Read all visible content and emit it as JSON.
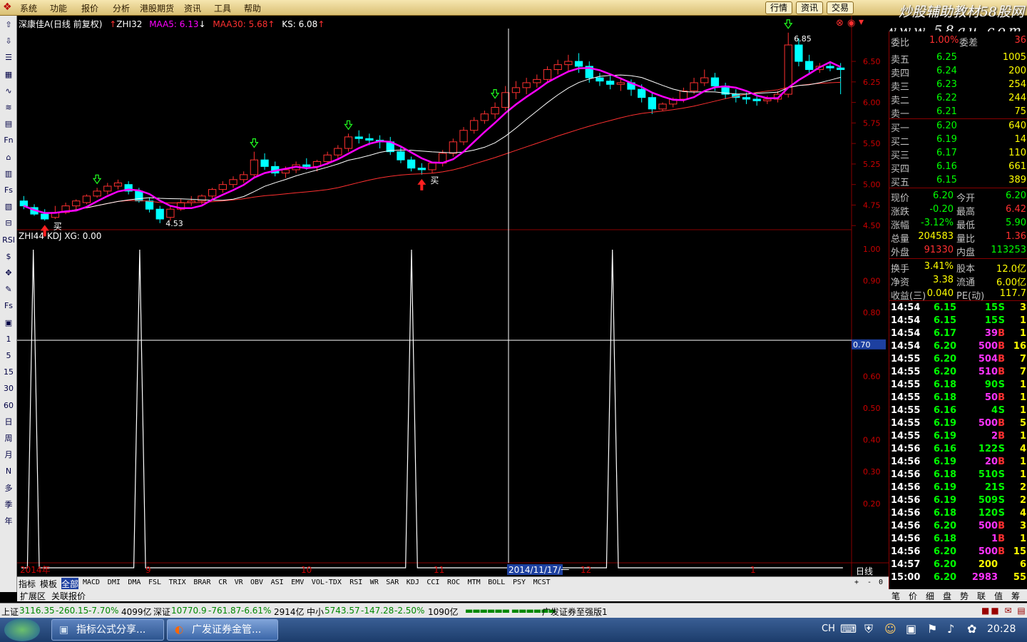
{
  "menu": {
    "items": [
      "系统",
      "功能",
      "报价",
      "分析",
      "港股期货",
      "资讯",
      "工具",
      "帮助"
    ],
    "center_title": "",
    "quick_buttons": [
      "行情",
      "资讯",
      "交易"
    ]
  },
  "watermark": {
    "line1": "炒股辅助教材58股网",
    "line2": "www.58gu.com"
  },
  "left_toolbar": [
    "⇧",
    "⇩",
    "☰",
    "▦",
    "∿",
    "≋",
    "▤",
    "Fn",
    "⌂",
    "▥",
    "Fs",
    "▧",
    "⊟",
    "RSI",
    "$",
    "✥",
    "✎",
    "Fs",
    "▣",
    "1",
    "5",
    "15",
    "30",
    "60",
    "日",
    "周",
    "月",
    "N",
    "多",
    "季",
    "年"
  ],
  "main_chart": {
    "stock": "深康佳A",
    "period": "(日线 前复权)",
    "ind": "ZHI32",
    "maa5_label": "MAA5: 6.13",
    "maa30_label": "MAA30: 5.68",
    "ks_label": "KS: 6.08",
    "y_ticks": [
      "6.50",
      "6.25",
      "6.00",
      "5.75",
      "5.50",
      "5.25",
      "5.00",
      "4.75",
      "4.50"
    ],
    "hi_label": "6.85",
    "lo_label": "4.53",
    "buy_label": "买"
  },
  "sub_chart": {
    "title": "ZHI44 KDJ XG: 0.00",
    "y_ticks": [
      "1.00",
      "0.90",
      "0.80",
      "0.70",
      "0.60",
      "0.50",
      "0.40",
      "0.30",
      "0.20"
    ],
    "cursor_value": "0.70"
  },
  "x_axis": {
    "labels": [
      "2014年",
      "9",
      "10",
      "11",
      "2014/11/17/一",
      "12",
      "1"
    ],
    "period": "日线"
  },
  "indicator_tabs": [
    "指标",
    "模板",
    "全部",
    "MACD",
    "DMI",
    "DMA",
    "FSL",
    "TRIX",
    "BRAR",
    "CR",
    "VR",
    "OBV",
    "ASI",
    "EMV",
    "VOL-TDX",
    "RSI",
    "WR",
    "SAR",
    "KDJ",
    "CCI",
    "ROC",
    "MTM",
    "BOLL",
    "PSY",
    "MCST"
  ],
  "indicator_tabs2": [
    "扩展区",
    "关联报价"
  ],
  "tab_controls": [
    "+",
    "-",
    "0"
  ],
  "quote": {
    "wei_label": "委比",
    "wei_value": "1.00%",
    "wei_cha_label": "委差",
    "wei_cha": "36",
    "asks": [
      {
        "label": "卖五",
        "price": "6.25",
        "vol": "1005"
      },
      {
        "label": "卖四",
        "price": "6.24",
        "vol": "200"
      },
      {
        "label": "卖三",
        "price": "6.23",
        "vol": "254"
      },
      {
        "label": "卖二",
        "price": "6.22",
        "vol": "244"
      },
      {
        "label": "卖一",
        "price": "6.21",
        "vol": "75"
      }
    ],
    "bids": [
      {
        "label": "买一",
        "price": "6.20",
        "vol": "640"
      },
      {
        "label": "买二",
        "price": "6.19",
        "vol": "14"
      },
      {
        "label": "买三",
        "price": "6.17",
        "vol": "110"
      },
      {
        "label": "买四",
        "price": "6.16",
        "vol": "661"
      },
      {
        "label": "买五",
        "price": "6.15",
        "vol": "389"
      }
    ],
    "stats": [
      {
        "l1": "现价",
        "v1": "6.20",
        "c1": "#00ff00",
        "l2": "今开",
        "v2": "6.20",
        "c2": "#00ff00"
      },
      {
        "l1": "涨跌",
        "v1": "-0.20",
        "c1": "#00ff00",
        "l2": "最高",
        "v2": "6.42",
        "c2": "#ff3030"
      },
      {
        "l1": "涨幅",
        "v1": "-3.12%",
        "c1": "#00ff00",
        "l2": "最低",
        "v2": "5.90",
        "c2": "#00ff00"
      },
      {
        "l1": "总量",
        "v1": "204583",
        "c1": "#ffff00",
        "l2": "量比",
        "v2": "1.36",
        "c2": "#ff3030"
      },
      {
        "l1": "外盘",
        "v1": "91330",
        "c1": "#ff3030",
        "l2": "内盘",
        "v2": "113253",
        "c2": "#00ff00"
      },
      {
        "l1": "换手",
        "v1": "3.41%",
        "c1": "#ffff00",
        "l2": "股本",
        "v2": "12.0亿",
        "c2": "#ffff00"
      },
      {
        "l1": "净资",
        "v1": "3.38",
        "c1": "#ffff00",
        "l2": "流通",
        "v2": "6.00亿",
        "c2": "#ffff00"
      },
      {
        "l1": "收益(三)",
        "v1": "0.040",
        "c1": "#ffff00",
        "l2": "PE(动)",
        "v2": "117.7",
        "c2": "#ffff00"
      }
    ]
  },
  "ticks": [
    {
      "t": "14:54",
      "p": "6.15",
      "v": "15",
      "s": "S",
      "n": "3"
    },
    {
      "t": "14:54",
      "p": "6.15",
      "v": "15",
      "s": "S",
      "n": "1"
    },
    {
      "t": "14:54",
      "p": "6.17",
      "v": "39",
      "s": "B",
      "n": "1"
    },
    {
      "t": "14:54",
      "p": "6.20",
      "v": "500",
      "s": "B",
      "n": "16"
    },
    {
      "t": "14:55",
      "p": "6.20",
      "v": "504",
      "s": "B",
      "n": "7"
    },
    {
      "t": "14:55",
      "p": "6.20",
      "v": "510",
      "s": "B",
      "n": "7"
    },
    {
      "t": "14:55",
      "p": "6.18",
      "v": "90",
      "s": "S",
      "n": "1"
    },
    {
      "t": "14:55",
      "p": "6.18",
      "v": "50",
      "s": "B",
      "n": "1"
    },
    {
      "t": "14:55",
      "p": "6.16",
      "v": "4",
      "s": "S",
      "n": "1"
    },
    {
      "t": "14:55",
      "p": "6.19",
      "v": "500",
      "s": "B",
      "n": "5"
    },
    {
      "t": "14:55",
      "p": "6.19",
      "v": "2",
      "s": "B",
      "n": "1"
    },
    {
      "t": "14:56",
      "p": "6.16",
      "v": "122",
      "s": "S",
      "n": "4"
    },
    {
      "t": "14:56",
      "p": "6.19",
      "v": "20",
      "s": "B",
      "n": "1"
    },
    {
      "t": "14:56",
      "p": "6.18",
      "v": "510",
      "s": "S",
      "n": "1"
    },
    {
      "t": "14:56",
      "p": "6.19",
      "v": "21",
      "s": "S",
      "n": "2"
    },
    {
      "t": "14:56",
      "p": "6.19",
      "v": "509",
      "s": "S",
      "n": "2"
    },
    {
      "t": "14:56",
      "p": "6.18",
      "v": "120",
      "s": "S",
      "n": "4"
    },
    {
      "t": "14:56",
      "p": "6.20",
      "v": "500",
      "s": "B",
      "n": "3"
    },
    {
      "t": "14:56",
      "p": "6.18",
      "v": "1",
      "s": "B",
      "n": "1"
    },
    {
      "t": "14:56",
      "p": "6.20",
      "v": "500",
      "s": "B",
      "n": "15"
    },
    {
      "t": "14:57",
      "p": "6.20",
      "v": "200",
      "s": "",
      "n": "6"
    },
    {
      "t": "15:00",
      "p": "6.20",
      "v": "2983",
      "s": "",
      "n": "55"
    }
  ],
  "right_tabs": [
    "笔",
    "价",
    "细",
    "盘",
    "势",
    "联",
    "值",
    "筹"
  ],
  "status": {
    "sh_label": "上证",
    "sh_val": "3116.35",
    "sh_chg": "-260.15",
    "sh_pct": "-7.70%",
    "sh_amt": "4099亿",
    "sz_label": "深证",
    "sz_val": "10770.9",
    "sz_chg": "-761.87",
    "sz_pct": "-6.61%",
    "sz_amt": "2914亿",
    "zx_label": "中小",
    "zx_val": "5743.57",
    "zx_chg": "-147.28",
    "zx_pct": "-2.50%",
    "zx_amt": "1090亿",
    "broker": "广发证券至强版1"
  },
  "taskbar": {
    "btn1": "指标公式分享...",
    "btn2": "广发证券金管...",
    "lang": "CH",
    "time": "20:28"
  },
  "colors": {
    "up": "#ff3030",
    "down": "#00ffff",
    "ma5": "#ff00ff",
    "ma30": "#ff3030",
    "ks": "#ffffff",
    "bid_green": "#00ff00"
  },
  "chart_data": [
    {
      "type": "candlestick",
      "title": "深康佳A (日线 前复权)",
      "ylim": [
        4.45,
        6.9
      ],
      "x_labels": [
        "2014年",
        "9",
        "10",
        "11",
        "12",
        "1"
      ],
      "candles": [
        [
          4.8,
          4.86,
          4.74,
          4.7
        ],
        [
          4.72,
          4.76,
          4.64,
          4.62
        ],
        [
          4.64,
          4.7,
          4.58,
          4.56
        ],
        [
          4.6,
          4.74,
          4.66,
          4.58
        ],
        [
          4.66,
          4.78,
          4.74,
          4.64
        ],
        [
          4.74,
          4.82,
          4.8,
          4.7
        ],
        [
          4.78,
          4.88,
          4.86,
          4.76
        ],
        [
          4.86,
          4.96,
          4.92,
          4.84
        ],
        [
          4.92,
          5.02,
          4.98,
          4.88
        ],
        [
          4.98,
          5.06,
          5.02,
          4.94
        ],
        [
          5.0,
          5.04,
          4.92,
          4.88
        ],
        [
          4.92,
          4.96,
          4.8,
          4.78
        ],
        [
          4.8,
          4.84,
          4.7,
          4.66
        ],
        [
          4.7,
          4.74,
          4.58,
          4.53
        ],
        [
          4.6,
          4.74,
          4.7,
          4.56
        ],
        [
          4.7,
          4.82,
          4.78,
          4.68
        ],
        [
          4.78,
          4.86,
          4.8,
          4.74
        ],
        [
          4.8,
          4.88,
          4.86,
          4.76
        ],
        [
          4.86,
          4.96,
          4.94,
          4.82
        ],
        [
          4.94,
          5.04,
          5.0,
          4.9
        ],
        [
          5.0,
          5.1,
          5.06,
          4.96
        ],
        [
          5.06,
          5.16,
          5.12,
          5.02
        ],
        [
          5.12,
          5.4,
          5.3,
          5.08
        ],
        [
          5.3,
          5.38,
          5.22,
          5.18
        ],
        [
          5.22,
          5.28,
          5.14,
          5.1
        ],
        [
          5.14,
          5.22,
          5.18,
          5.08
        ],
        [
          5.18,
          5.28,
          5.24,
          5.14
        ],
        [
          5.24,
          5.32,
          5.22,
          5.18
        ],
        [
          5.22,
          5.3,
          5.28,
          5.16
        ],
        [
          5.28,
          5.4,
          5.36,
          5.24
        ],
        [
          5.36,
          5.48,
          5.44,
          5.32
        ],
        [
          5.44,
          5.62,
          5.58,
          5.4
        ],
        [
          5.58,
          5.66,
          5.56,
          5.5
        ],
        [
          5.56,
          5.62,
          5.54,
          5.48
        ],
        [
          5.54,
          5.6,
          5.52,
          5.44
        ],
        [
          5.52,
          5.58,
          5.4,
          5.36
        ],
        [
          5.4,
          5.46,
          5.3,
          5.26
        ],
        [
          5.3,
          5.34,
          5.2,
          5.16
        ],
        [
          5.2,
          5.26,
          5.18,
          5.12
        ],
        [
          5.18,
          5.28,
          5.26,
          5.14
        ],
        [
          5.26,
          5.42,
          5.38,
          5.22
        ],
        [
          5.38,
          5.56,
          5.52,
          5.34
        ],
        [
          5.52,
          5.7,
          5.66,
          5.48
        ],
        [
          5.66,
          5.82,
          5.78,
          5.62
        ],
        [
          5.78,
          5.9,
          5.86,
          5.74
        ],
        [
          5.86,
          6.0,
          5.94,
          5.8
        ],
        [
          5.94,
          6.2,
          6.12,
          5.9
        ],
        [
          6.12,
          6.26,
          6.18,
          6.04
        ],
        [
          6.18,
          6.3,
          6.24,
          6.1
        ],
        [
          6.24,
          6.34,
          6.28,
          6.18
        ],
        [
          6.28,
          6.44,
          6.4,
          6.24
        ],
        [
          6.4,
          6.52,
          6.46,
          6.34
        ],
        [
          6.46,
          6.58,
          6.5,
          6.38
        ],
        [
          6.5,
          6.6,
          6.44,
          6.36
        ],
        [
          6.44,
          6.5,
          6.3,
          6.24
        ],
        [
          6.3,
          6.36,
          6.26,
          6.2
        ],
        [
          6.26,
          6.32,
          6.22,
          6.16
        ],
        [
          6.22,
          6.3,
          6.24,
          6.14
        ],
        [
          6.24,
          6.28,
          6.16,
          6.08
        ],
        [
          6.16,
          6.22,
          6.06,
          6.0
        ],
        [
          6.06,
          6.12,
          5.92,
          5.86
        ],
        [
          5.92,
          6.0,
          5.98,
          5.9
        ],
        [
          5.98,
          6.06,
          6.04,
          5.94
        ],
        [
          6.04,
          6.18,
          6.14,
          6.0
        ],
        [
          6.14,
          6.3,
          6.24,
          6.1
        ],
        [
          6.24,
          6.4,
          6.3,
          6.2
        ],
        [
          6.3,
          6.36,
          6.2,
          6.14
        ],
        [
          6.2,
          6.24,
          6.1,
          6.04
        ],
        [
          6.1,
          6.16,
          6.06,
          6.0
        ],
        [
          6.06,
          6.12,
          6.04,
          5.98
        ],
        [
          6.04,
          6.1,
          6.02,
          5.96
        ],
        [
          6.02,
          6.08,
          6.04,
          5.98
        ],
        [
          6.04,
          6.14,
          6.1,
          6.0
        ],
        [
          6.1,
          6.85,
          6.7,
          6.06
        ],
        [
          6.7,
          6.78,
          6.5,
          6.44
        ],
        [
          6.5,
          6.58,
          6.4,
          6.34
        ],
        [
          6.4,
          6.48,
          6.44,
          6.36
        ],
        [
          6.44,
          6.5,
          6.42,
          6.38
        ],
        [
          6.42,
          6.48,
          6.4,
          6.1
        ]
      ]
    },
    {
      "type": "line",
      "title": "ZHI44 KDJ XG",
      "ylim": [
        0,
        1
      ],
      "spikes_at": [
        2,
        20,
        66,
        100
      ],
      "n": 140
    }
  ]
}
